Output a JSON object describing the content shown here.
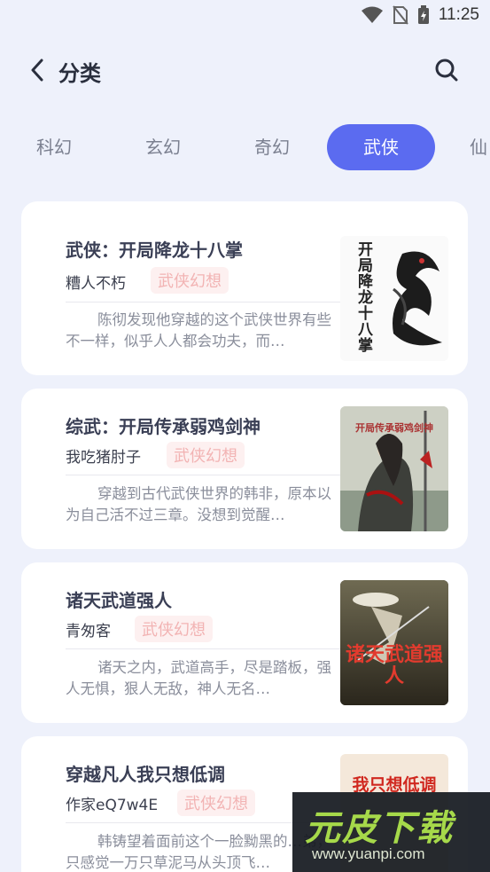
{
  "status": {
    "time": "11:25"
  },
  "header": {
    "title": "分类"
  },
  "tabs": [
    {
      "label": "科幻"
    },
    {
      "label": "玄幻"
    },
    {
      "label": "奇幻"
    },
    {
      "label": "武侠"
    },
    {
      "label": "仙"
    }
  ],
  "active_tab": "武侠",
  "books": [
    {
      "title": "武侠：开局降龙十八掌",
      "author": "糟人不朽",
      "tag": "武侠幻想",
      "desc": "陈彻发现他穿越的这个武侠世界有些不一样，似乎人人都会功夫，而…",
      "cover_text": "开局降龙十八掌"
    },
    {
      "title": "综武：开局传承弱鸡剑神",
      "author": "我吃猪肘子",
      "tag": "武侠幻想",
      "desc": "穿越到古代武侠世界的韩非，原本以为自己活不过三章。没想到觉醒…",
      "cover_text": "开局传承弱鸡剑神"
    },
    {
      "title": "诸天武道强人",
      "author": "青匆客",
      "tag": "武侠幻想",
      "desc": "诸天之内，武道高手，尽是踏板，强人无惧，狠人无敌，神人无名…",
      "cover_text": "诸天武道强人"
    },
    {
      "title": "穿越凡人我只想低调",
      "author": "作家eQ7w4E",
      "tag": "武侠幻想",
      "desc": "韩铸望着面前这个一脸黝黑的…弟，只感觉一万只草泥马从头顶飞…",
      "cover_text": "我只想低调"
    }
  ],
  "watermark": {
    "main": "元皮下载",
    "sub": "www.yuanpi.com"
  },
  "colors": {
    "accent": "#5b6bf0",
    "background": "#eef1fb",
    "tag_text": "#f2b3b3",
    "tag_bg": "#fdf0f0"
  }
}
